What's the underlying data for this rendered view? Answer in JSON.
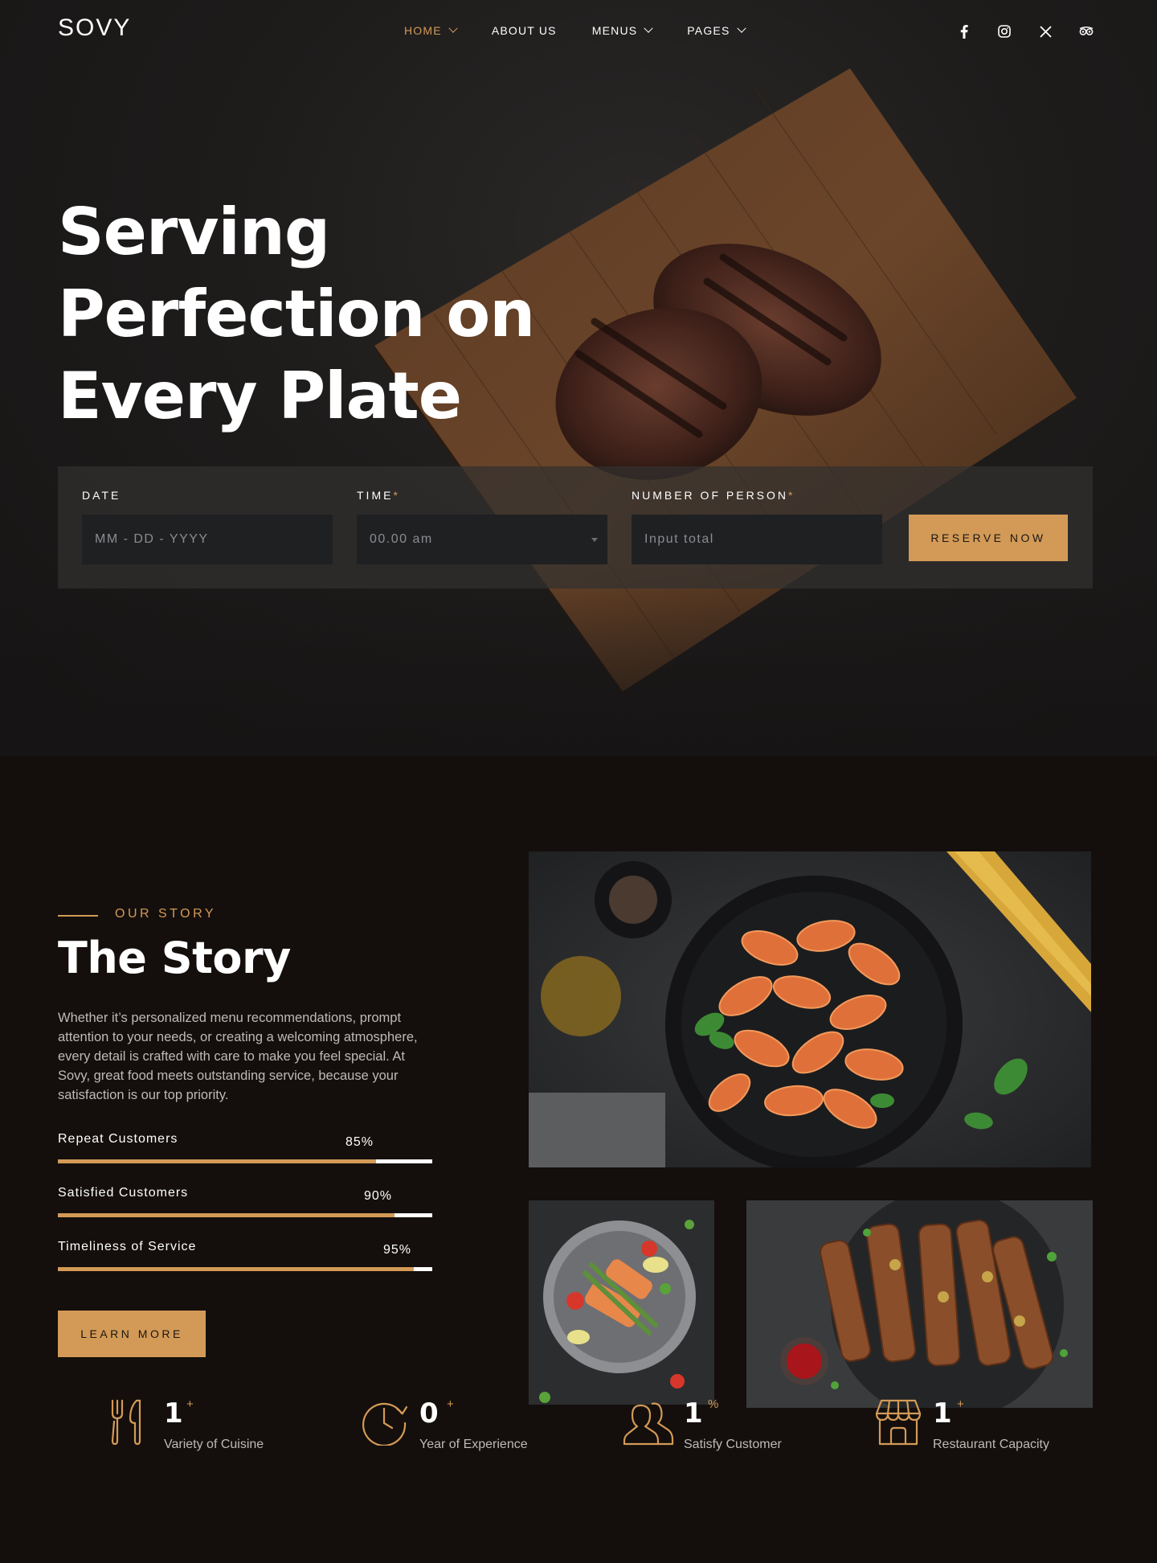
{
  "brand": {
    "name": "SOVY",
    "accent": "#d39a57"
  },
  "nav": [
    {
      "label": "HOME",
      "active": true,
      "dropdown": true
    },
    {
      "label": "ABOUT US",
      "active": false,
      "dropdown": false
    },
    {
      "label": "MENUS",
      "active": false,
      "dropdown": true
    },
    {
      "label": "PAGES",
      "active": false,
      "dropdown": true
    }
  ],
  "social": [
    "facebook-icon",
    "instagram-icon",
    "x-icon",
    "tripadvisor-icon"
  ],
  "hero": {
    "title_line1": "Serving",
    "title_line2": "Perfection on",
    "title_line3": "Every Plate"
  },
  "reservation": {
    "date_label": "DATE",
    "date_placeholder": "MM - DD - YYYY",
    "time_label": "TIME",
    "time_placeholder": "00.00 am",
    "persons_label": "NUMBER OF PERSON",
    "persons_placeholder": "Input total",
    "required_mark": "*",
    "button_label": "RESERVE NOW"
  },
  "story": {
    "kicker": "OUR STORY",
    "title": "The Story",
    "text": "Whether it’s personalized menu recommendations, prompt attention to your needs, or creating a welcoming atmosphere, every detail is crafted with care to make you feel special. At Sovy, great food meets outstanding service, because your satisfaction is our top priority.",
    "progress": [
      {
        "label": "Repeat Customers",
        "value": 85,
        "display": "85%"
      },
      {
        "label": "Satisfied Customers",
        "value": 90,
        "display": "90%"
      },
      {
        "label": "Timeliness of Service",
        "value": 95,
        "display": "95%"
      }
    ],
    "button_label": "LEARN MORE"
  },
  "stats": [
    {
      "icon": "fork-knife-icon",
      "number": "1",
      "suffix": "+",
      "label": "Variety of Cuisine"
    },
    {
      "icon": "clock-icon",
      "number": "0",
      "suffix": "+",
      "label": "Year of Experience"
    },
    {
      "icon": "users-icon",
      "number": "1",
      "suffix": "%",
      "label": "Satisfy Customer"
    },
    {
      "icon": "store-icon",
      "number": "1",
      "suffix": "+",
      "label": "Restaurant Capacity"
    }
  ]
}
